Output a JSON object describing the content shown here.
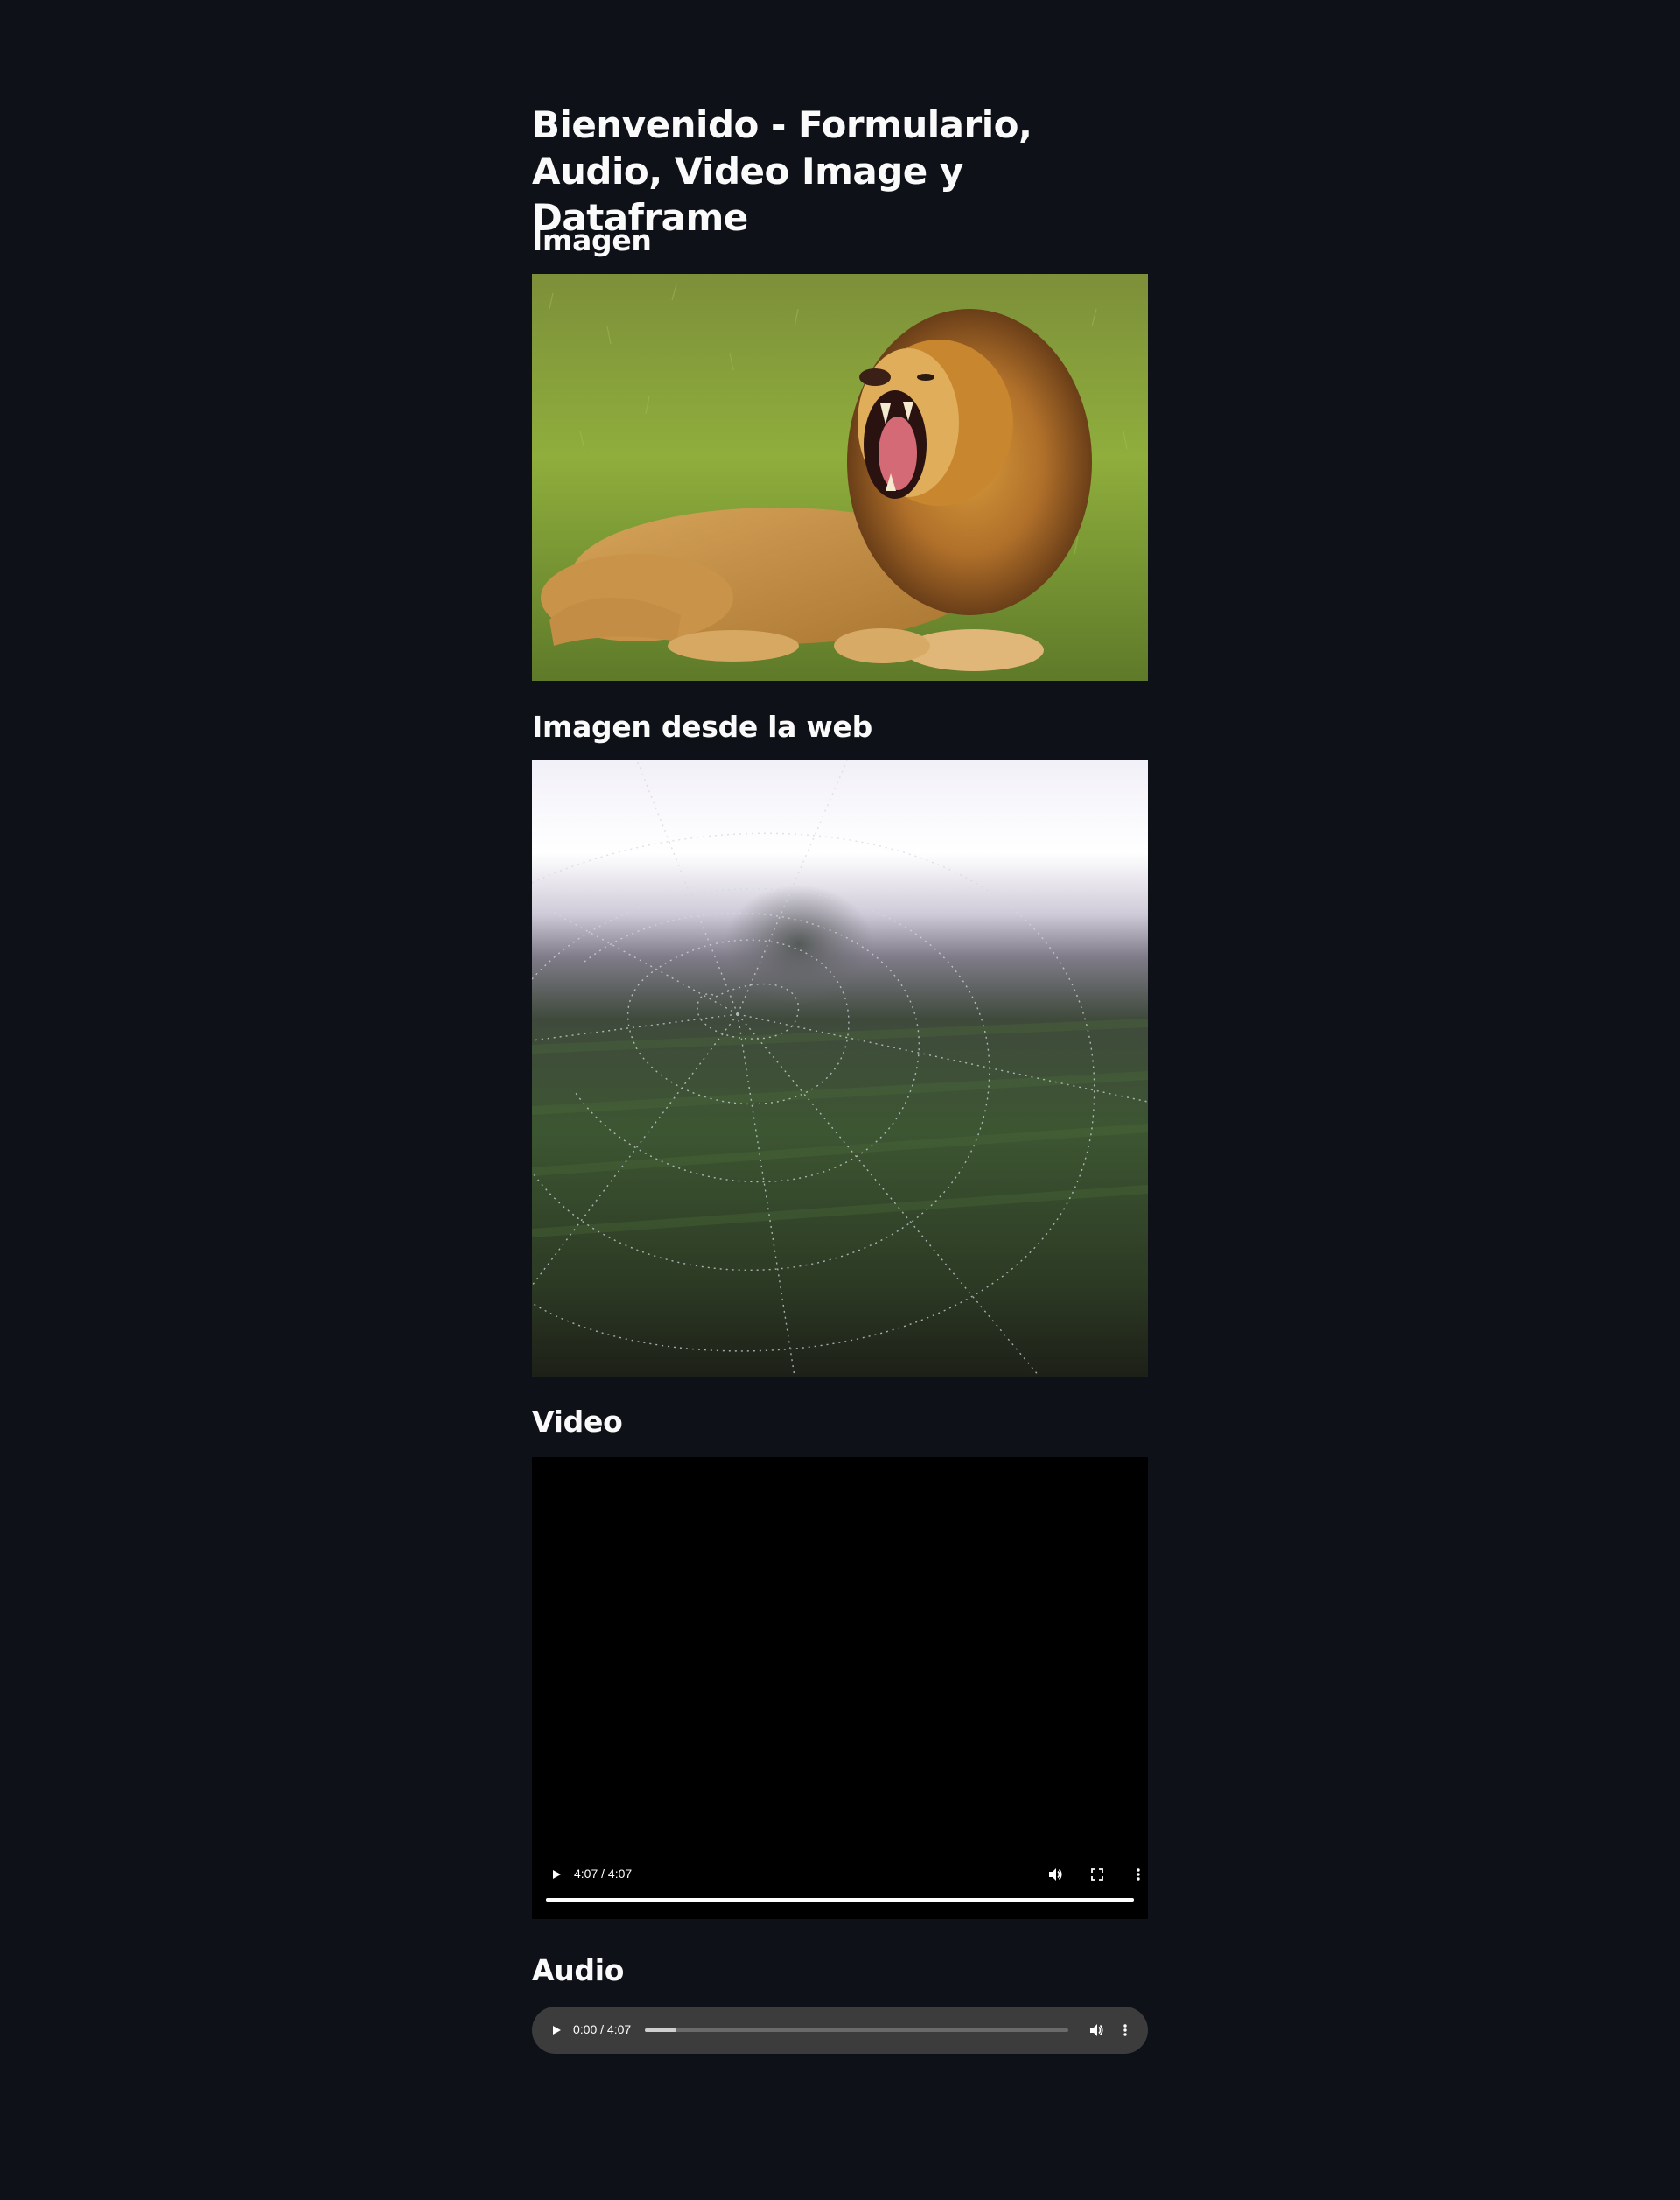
{
  "page": {
    "title": "Bienvenido - Formulario, Audio, Video Image y Dataframe",
    "background": "#0e1117"
  },
  "sections": {
    "image": {
      "heading": "Imagen",
      "image_subject": "yawning lion lying on grass"
    },
    "web_image": {
      "heading": "Imagen desde la web",
      "image_subject": "dew-covered spider web over a misty field"
    },
    "video": {
      "heading": "Video",
      "time_text": "4:07 / 4:07",
      "progress": 1.0,
      "icons": [
        "play-icon",
        "volume-icon",
        "fullscreen-icon",
        "more-options-icon"
      ]
    },
    "audio": {
      "heading": "Audio",
      "time_text": "0:00 / 4:07",
      "progress": 0.075,
      "icons": [
        "play-icon",
        "volume-icon",
        "more-options-icon"
      ]
    }
  }
}
